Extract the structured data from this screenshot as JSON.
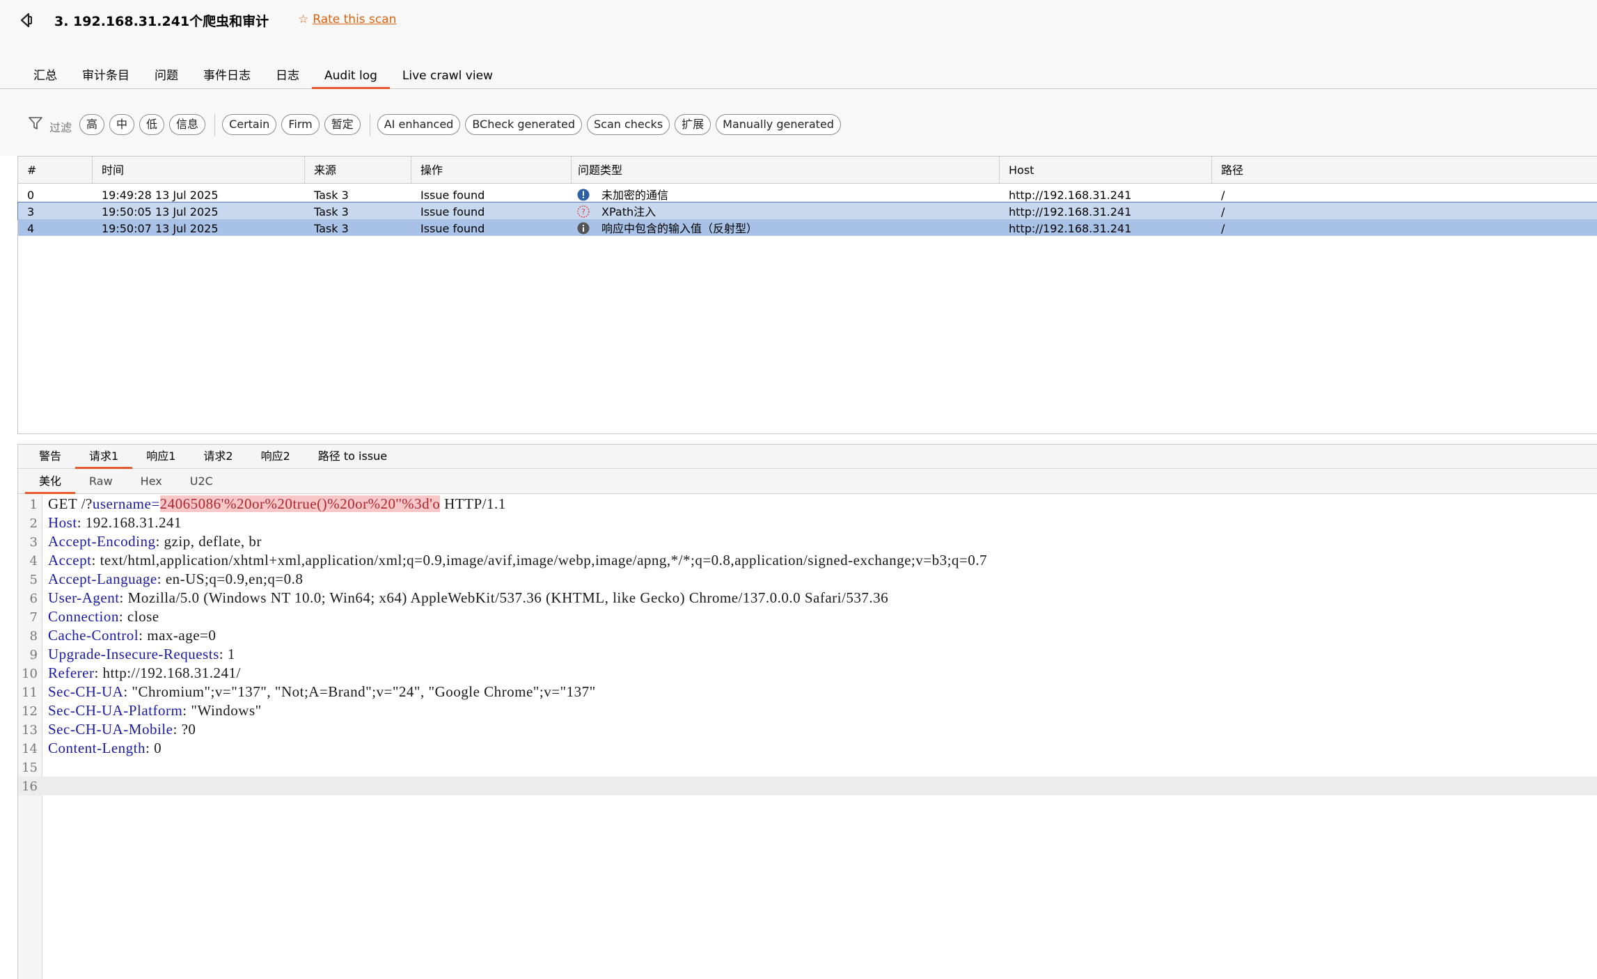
{
  "header": {
    "title": "3. 192.168.31.241个爬虫和审计",
    "rate_link": "Rate this scan"
  },
  "tabs": [
    "汇总",
    "审计条目",
    "问题",
    "事件日志",
    "日志",
    "Audit log",
    "Live crawl view"
  ],
  "active_tab": "Audit log",
  "filter": {
    "label": "过滤",
    "severity": [
      "高",
      "中",
      "低",
      "信息"
    ],
    "confidence": [
      "Certain",
      "Firm",
      "暂定"
    ],
    "sources": [
      "AI enhanced",
      "BCheck generated",
      "Scan checks",
      "扩展",
      "Manually generated"
    ]
  },
  "table": {
    "columns": [
      "#",
      "时间",
      "来源",
      "操作",
      "问题类型",
      "Host",
      "路径"
    ],
    "rows": [
      {
        "num": "0",
        "time": "19:49:28 13 Jul 2025",
        "source": "Task 3",
        "action": "Issue found",
        "severity": "high-info",
        "issue": "未加密的通信",
        "host": "http://192.168.31.241",
        "path": "/"
      },
      {
        "num": "3",
        "time": "19:50:05 13 Jul 2025",
        "source": "Task 3",
        "action": "Issue found",
        "severity": "tentative",
        "issue": "XPath注入",
        "host": "http://192.168.31.241",
        "path": "/"
      },
      {
        "num": "4",
        "time": "19:50:07 13 Jul 2025",
        "source": "Task 3",
        "action": "Issue found",
        "severity": "info",
        "issue": "响应中包含的输入值（反射型）",
        "host": "http://192.168.31.241",
        "path": "/"
      }
    ]
  },
  "detail_tabs": [
    "警告",
    "请求1",
    "响应1",
    "请求2",
    "响应2",
    "路径 to issue"
  ],
  "active_detail_tab": "请求1",
  "sub_tabs": [
    "美化",
    "Raw",
    "Hex",
    "U2C"
  ],
  "active_sub_tab": "美化",
  "request": {
    "request_line": {
      "method": "GET /?",
      "param": "username=",
      "value": "24065086'%20or%20true()%20or%20''%3d'o",
      "proto": " HTTP/1.1"
    },
    "headers": [
      {
        "k": "Host",
        "v": "192.168.31.241"
      },
      {
        "k": "Accept-Encoding",
        "v": "gzip, deflate, br"
      },
      {
        "k": "Accept",
        "v": "text/html,application/xhtml+xml,application/xml;q=0.9,image/avif,image/webp,image/apng,*/*;q=0.8,application/signed-exchange;v=b3;q=0.7"
      },
      {
        "k": "Accept-Language",
        "v": "en-US;q=0.9,en;q=0.8"
      },
      {
        "k": "User-Agent",
        "v": "Mozilla/5.0 (Windows NT 10.0; Win64; x64) AppleWebKit/537.36 (KHTML, like Gecko) Chrome/137.0.0.0 Safari/537.36"
      },
      {
        "k": "Connection",
        "v": "close"
      },
      {
        "k": "Cache-Control",
        "v": "max-age=0"
      },
      {
        "k": "Upgrade-Insecure-Requests",
        "v": "1"
      },
      {
        "k": "Referer",
        "v": "http://192.168.31.241/"
      },
      {
        "k": "Sec-CH-UA",
        "v": "\"Chromium\";v=\"137\", \"Not;A=Brand\";v=\"24\", \"Google Chrome\";v=\"137\""
      },
      {
        "k": "Sec-CH-UA-Platform",
        "v": "\"Windows\""
      },
      {
        "k": "Sec-CH-UA-Mobile",
        "v": "?0"
      },
      {
        "k": "Content-Length",
        "v": "0"
      }
    ],
    "line_numbers": [
      "1",
      "2",
      "3",
      "4",
      "5",
      "6",
      "7",
      "8",
      "9",
      "10",
      "11",
      "12",
      "13",
      "14",
      "15",
      "16"
    ]
  },
  "colors": {
    "accent": "#e8582c",
    "link": "#d9620f",
    "row_selected": "#c8d9ef",
    "row_selected_strong": "#a7c2e6",
    "header_key": "#1a1aa6"
  }
}
